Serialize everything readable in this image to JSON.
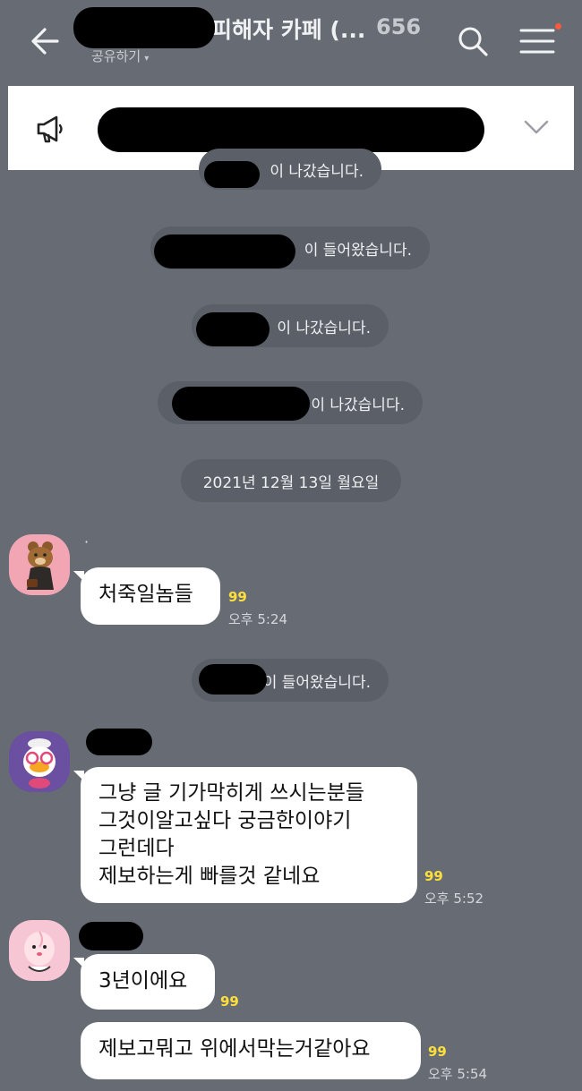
{
  "header": {
    "title": "피해자 카페 (...",
    "member_count": "656",
    "share_label": "공유하기",
    "share_caret": "▾"
  },
  "system_messages": [
    {
      "text": "이 나갔습니다."
    },
    {
      "text": "이 들어왔습니다."
    },
    {
      "text": "이 나갔습니다."
    },
    {
      "text": "이 나갔습니다."
    },
    {
      "text": "이 들어왔습니다."
    }
  ],
  "date_divider": "2021년 12월 13일 월요일",
  "messages": [
    {
      "sender": "·",
      "bubbles": [
        "처죽일놈들"
      ],
      "unread": "99",
      "time": "오후 5:24"
    },
    {
      "sender": "",
      "bubbles": [
        "그냥 글 기가막히게 쓰시는분들\n그것이알고싶다 궁금한이야기\n그런데다\n제보하는게 빠를것 같네요"
      ],
      "unread": "99",
      "time": "오후 5:52"
    },
    {
      "sender": "",
      "bubbles": [
        "3년이에요",
        "제보고뭐고 위에서막는거같아요"
      ],
      "unread": [
        "99",
        "99"
      ],
      "time": "오후 5:54"
    }
  ],
  "colors": {
    "background": "#666b74",
    "pill": "#5b6068",
    "unread": "#ffe03a",
    "notice_text": "#2a66d6",
    "menu_dot": "#ff5a3c"
  },
  "icons": {
    "back": "arrow-left",
    "search": "magnifier",
    "menu": "hamburger",
    "notice": "megaphone",
    "expand": "chevron-down"
  }
}
